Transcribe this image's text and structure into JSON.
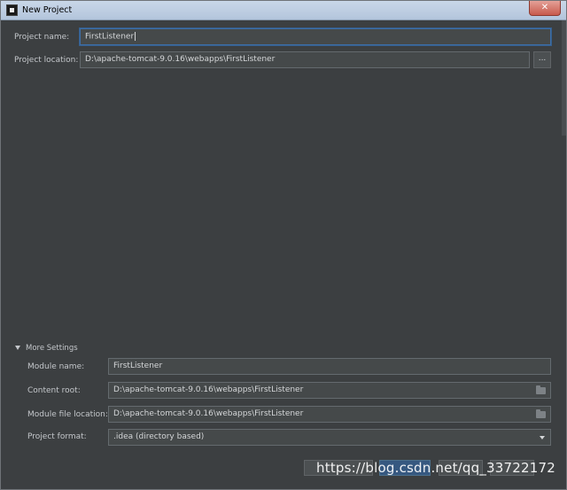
{
  "window": {
    "title": "New Project",
    "title_ghost": "…             ",
    "close_glyph": "✕"
  },
  "project": {
    "name_label": "Project name:",
    "name_value": "FirstListener",
    "location_label": "Project location:",
    "location_value": "D:\\apache-tomcat-9.0.16\\webapps\\FirstListener",
    "browse_label": "..."
  },
  "more_settings": {
    "label": "More Settings",
    "module_name_label": "Module name:",
    "module_name_value": "FirstListener",
    "content_root_label": "Content root:",
    "content_root_value": "D:\\apache-tomcat-9.0.16\\webapps\\FirstListener",
    "module_file_label": "Module file location:",
    "module_file_value": "D:\\apache-tomcat-9.0.16\\webapps\\FirstListener",
    "format_label": "Project format:",
    "format_value": ".idea (directory based)"
  },
  "footer": {
    "watermark": "https://blog.csdn.net/qq_33722172"
  },
  "icons": [
    "app-icon",
    "close-icon",
    "folder-icon",
    "chevron-down-icon",
    "collapse-triangle-icon"
  ],
  "colors": {
    "background": "#3c3f41",
    "field": "#45494a",
    "focus_border": "#3d6ea8",
    "primary_button": "#365880"
  }
}
